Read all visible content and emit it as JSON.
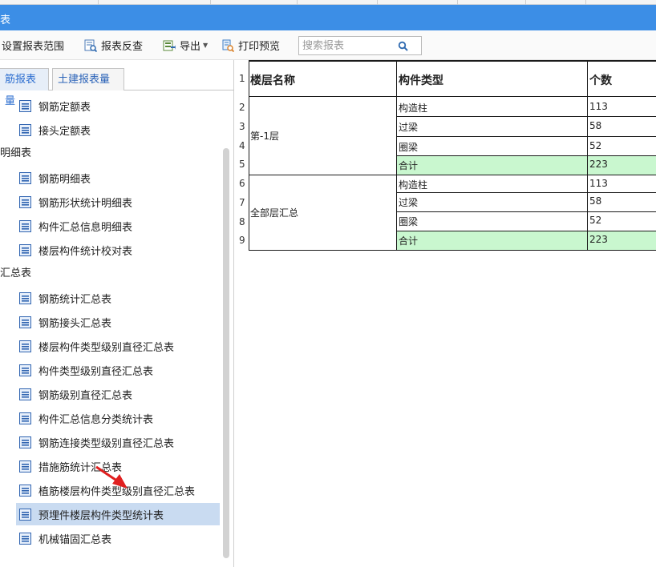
{
  "titlebar": {
    "title": "表"
  },
  "toolbar": {
    "set_range": "设置报表范围",
    "report_reverse": "报表反查",
    "export": "导出",
    "print_preview": "打印预览",
    "search_placeholder": "搜索报表"
  },
  "tabs": [
    {
      "label": "筋报表量"
    },
    {
      "label": "土建报表量"
    }
  ],
  "tree": {
    "items_top": [
      "钢筋定额表",
      "接头定额表"
    ],
    "group1": "明细表",
    "group1_items": [
      "钢筋明细表",
      "钢筋形状统计明细表",
      "构件汇总信息明细表",
      "楼层构件统计校对表"
    ],
    "group2": "汇总表",
    "group2_items": [
      "钢筋统计汇总表",
      "钢筋接头汇总表",
      "楼层构件类型级别直径汇总表",
      "构件类型级别直径汇总表",
      "钢筋级别直径汇总表",
      "构件汇总信息分类统计表",
      "钢筋连接类型级别直径汇总表",
      "措施筋统计汇总表",
      "植筋楼层构件类型级别直径汇总表",
      "预埋件楼层构件类型统计表",
      "机械锚固汇总表"
    ]
  },
  "table": {
    "row_numbers": [
      "1",
      "2",
      "3",
      "4",
      "5",
      "6",
      "7",
      "8",
      "9"
    ],
    "headers": [
      "楼层名称",
      "构件类型",
      "个数"
    ],
    "floors": [
      "第-1层",
      "全部层汇总"
    ],
    "rows": [
      {
        "type": "构造柱",
        "count": "113"
      },
      {
        "type": "过梁",
        "count": "58"
      },
      {
        "type": "圈梁",
        "count": "52"
      },
      {
        "type": "合计",
        "count": "223"
      },
      {
        "type": "构造柱",
        "count": "113"
      },
      {
        "type": "过梁",
        "count": "58"
      },
      {
        "type": "圈梁",
        "count": "52"
      },
      {
        "type": "合计",
        "count": "223"
      }
    ]
  },
  "colors": {
    "titlebar": "#3c8ee6",
    "total_row": "#c9f7cf",
    "selected_item": "#c9dbf1",
    "arrow": "#e02020"
  }
}
